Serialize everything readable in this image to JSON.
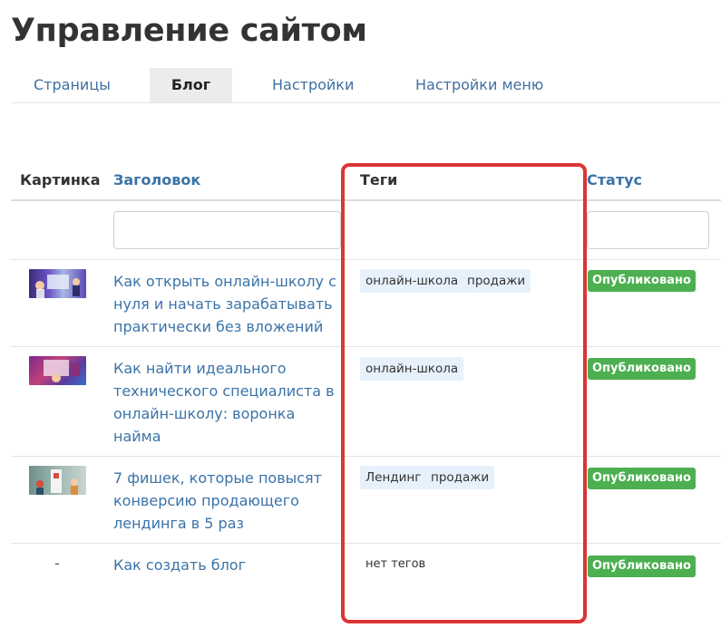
{
  "page": {
    "title": "Управление сайтом"
  },
  "tabs": [
    {
      "label": "Страницы"
    },
    {
      "label": "Блог"
    },
    {
      "label": "Настройки"
    },
    {
      "label": "Настройки меню"
    }
  ],
  "table": {
    "headers": {
      "image": "Картинка",
      "title": "Заголовок",
      "tags": "Теги",
      "status": "Статус"
    },
    "rows": [
      {
        "title": "Как открыть онлайн-школу с нуля и начать зарабатывать практически без вложений",
        "tags": [
          "онлайн-школа",
          "продажи"
        ],
        "status": "Опубликовано"
      },
      {
        "title": "Как найти идеального технического специалиста в онлайн-школу: воронка найма",
        "tags": [
          "онлайн-школа"
        ],
        "status": "Опубликовано"
      },
      {
        "title": "7 фишек, которые повысят конверсию продающего лендинга в 5 раз",
        "tags": [
          "Лендинг",
          "продажи"
        ],
        "status": "Опубликовано"
      },
      {
        "image_placeholder": "-",
        "title": "Как создать блог",
        "no_tags": "нет тегов",
        "status": "Опубликовано"
      }
    ]
  },
  "colors": {
    "accent_link": "#3a73a8",
    "published": "#4caf50",
    "highlight": "#dc3535",
    "tag_bg": "#e7f1fb"
  }
}
